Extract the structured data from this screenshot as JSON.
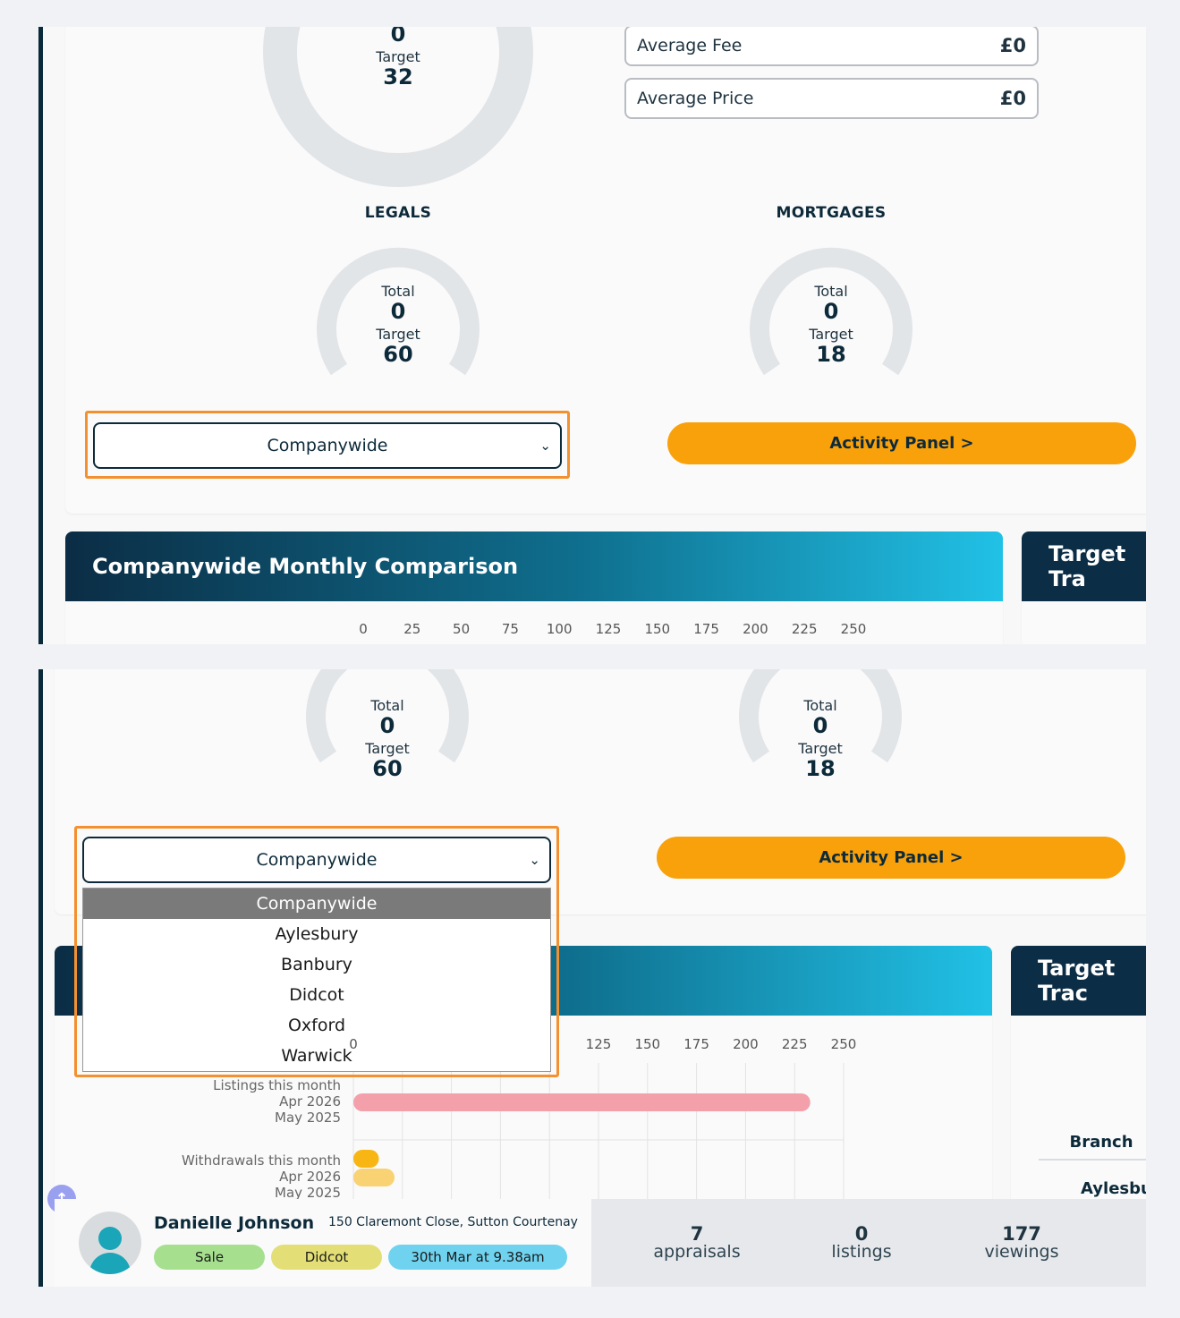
{
  "top_view": {
    "conversion_gauge": {
      "value": "0",
      "target_label": "Target",
      "target": "32"
    },
    "info_boxes": [
      {
        "label": "Average Fee",
        "value": "£0"
      },
      {
        "label": "Average Price",
        "value": "£0"
      }
    ],
    "legals": {
      "title": "LEGALS",
      "total_label": "Total",
      "total": "0",
      "target_label": "Target",
      "target": "60"
    },
    "mortgages": {
      "title": "MORTGAGES",
      "total_label": "Total",
      "total": "0",
      "target_label": "Target",
      "target": "18"
    },
    "branch_select": {
      "value": "Companywide"
    },
    "activity_button": "Activity Panel >",
    "comparison_title": "Companywide Monthly Comparison",
    "target_tracker_title": "Target Tra",
    "axis_ticks": [
      "0",
      "25",
      "50",
      "75",
      "100",
      "125",
      "150",
      "175",
      "200",
      "225",
      "250"
    ]
  },
  "bottom_view": {
    "legals": {
      "total_label": "Total",
      "total": "0",
      "target_label": "Target",
      "target": "60"
    },
    "mortgages": {
      "total_label": "Total",
      "total": "0",
      "target_label": "Target",
      "target": "18"
    },
    "branch_select": {
      "value": "Companywide"
    },
    "dropdown_options": [
      "Companywide",
      "Aylesbury",
      "Banbury",
      "Didcot",
      "Oxford",
      "Warwick"
    ],
    "activity_button": "Activity Panel >",
    "target_tracker_title": "Target Trac",
    "axis_ticks": [
      "0",
      "125",
      "150",
      "175",
      "200",
      "225",
      "250"
    ],
    "rows": [
      {
        "title": "Listings this month",
        "lines": [
          "Apr 2026",
          "May 2025"
        ]
      },
      {
        "title": "Withdrawals this month",
        "lines": [
          "Apr 2026",
          "May 2025"
        ]
      }
    ],
    "branch_table": {
      "header": "Branch",
      "first_row": "Aylesbur"
    },
    "colors": {
      "listings_bar": "#f4a0ab",
      "withdrawals_bar_1": "#f7b614",
      "withdrawals_bar_2": "#f9d274"
    }
  },
  "chart_data": {
    "type": "bar",
    "categories": [
      "Listings this month - Apr 2026",
      "Listings this month - May 2025",
      "Withdrawals this month - Apr 2026",
      "Withdrawals this month - May 2025"
    ],
    "values": [
      0,
      233,
      13,
      21
    ],
    "xlim": [
      0,
      250
    ]
  },
  "activity_card": {
    "name": "Danielle Johnson",
    "address": "150 Claremont Close, Sutton Courtenay",
    "badges": [
      {
        "text": "Sale",
        "color": "#a6e08f"
      },
      {
        "text": "Didcot",
        "color": "#e3df76"
      },
      {
        "text": "30th Mar at 9.38am",
        "color": "#6fd3f0"
      }
    ],
    "stats": [
      {
        "n": "7",
        "l": "appraisals"
      },
      {
        "n": "0",
        "l": "listings"
      },
      {
        "n": "177",
        "l": "viewings"
      }
    ]
  }
}
